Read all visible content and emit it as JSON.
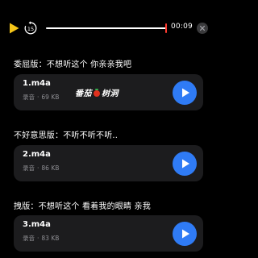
{
  "player": {
    "time": "00:09",
    "replay_seconds": "15",
    "progress": 0.98
  },
  "recordings": [
    {
      "caption": "委屈版：不想听这个 你亲亲我吧",
      "filename": "1.m4a",
      "type": "录音",
      "size": "69 KB"
    },
    {
      "caption": "不好意思版：不听不听不听..",
      "filename": "2.m4a",
      "type": "录音",
      "size": "86 KB"
    },
    {
      "caption": "拽版：不想听这个 看着我的眼睛 亲我",
      "filename": "3.m4a",
      "type": "录音",
      "size": "83 KB"
    }
  ],
  "watermark": {
    "left": "番茄",
    "right": "树洞"
  },
  "colors": {
    "accent": "#2f7bf5",
    "play_icon": "#f5c518",
    "playhead": "#ff3b30",
    "card_bg": "#1c1c1e",
    "muted_text": "#8e8e93"
  },
  "icons": {
    "play": "play-icon",
    "replay": "replay-15-icon",
    "close": "close-icon",
    "card_play": "play-icon"
  }
}
